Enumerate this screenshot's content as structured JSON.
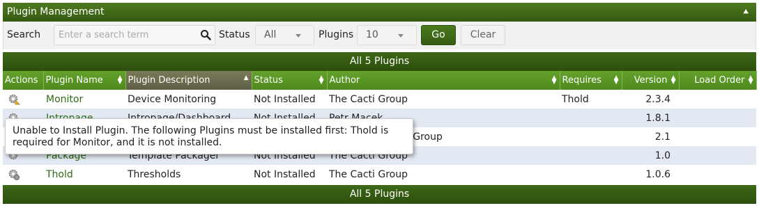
{
  "header": {
    "title": "Plugin Management",
    "collapse_icon": "double-chevron-up-icon"
  },
  "filter": {
    "search_label": "Search",
    "search_placeholder": "Enter a search term",
    "status_label": "Status",
    "status_value": "All",
    "plugins_label": "Plugins",
    "plugins_value": "10",
    "go_label": "Go",
    "clear_label": "Clear"
  },
  "table": {
    "caption": "All 5 Plugins",
    "columns": [
      "Actions",
      "Plugin Name",
      "Plugin Description",
      "Status",
      "Author",
      "Requires",
      "Version",
      "Load Order"
    ],
    "rows": [
      {
        "name": "Monitor",
        "description": "Device Monitoring",
        "status": "Not Installed",
        "author": "The Cacti Group",
        "requires": "Thold",
        "version": "2.3.4",
        "load_order": ""
      },
      {
        "name": "Intropage",
        "description": "Intropage/Dashboard",
        "status": "Not Installed",
        "author": "Petr Macek",
        "requires": "",
        "version": "1.8.1",
        "load_order": ""
      },
      {
        "name": "",
        "description": "",
        "status": "",
        "author": "kiweb, The Cacti Group",
        "requires": "",
        "version": "2.1",
        "load_order": ""
      },
      {
        "name": "Package",
        "description": "Template Packager",
        "status": "Not Installed",
        "author": "The Cacti Group",
        "requires": "",
        "version": "1.0",
        "load_order": ""
      },
      {
        "name": "Thold",
        "description": "Thresholds",
        "status": "Not Installed",
        "author": "The Cacti Group",
        "requires": "",
        "version": "1.0.6",
        "load_order": ""
      }
    ],
    "footer_caption": "All 5 Plugins"
  },
  "tooltip": {
    "text": "Unable to Install Plugin. The following Plugins must be installed first: Thold is required for Monitor, and it is not installed."
  },
  "colors": {
    "header_green": "#355a12",
    "column_green": "#5a9626",
    "link_green": "#2e6c14"
  }
}
